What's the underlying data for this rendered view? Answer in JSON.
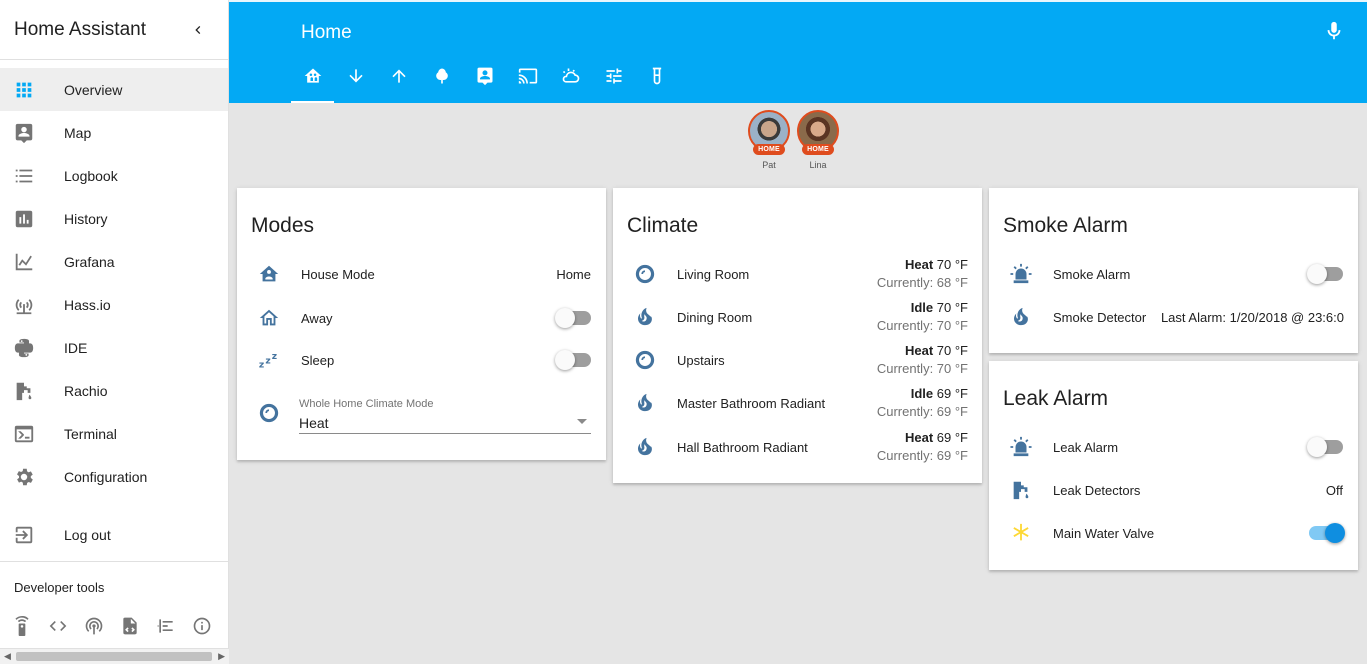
{
  "sidebar": {
    "title": "Home Assistant",
    "items": [
      {
        "label": "Overview",
        "icon": "apps-grid-icon"
      },
      {
        "label": "Map",
        "icon": "map-person-icon"
      },
      {
        "label": "Logbook",
        "icon": "list-icon"
      },
      {
        "label": "History",
        "icon": "bar-chart-icon"
      },
      {
        "label": "Grafana",
        "icon": "line-chart-icon"
      },
      {
        "label": "Hass.io",
        "icon": "antenna-icon"
      },
      {
        "label": "IDE",
        "icon": "python-icon"
      },
      {
        "label": "Rachio",
        "icon": "water-pump-icon"
      },
      {
        "label": "Terminal",
        "icon": "console-icon"
      },
      {
        "label": "Configuration",
        "icon": "gear-icon"
      },
      {
        "label": "Log out",
        "icon": "exit-icon"
      }
    ],
    "dev_tools_title": "Developer tools",
    "dev_tools": [
      "remote-icon",
      "code-icon",
      "radio-tower-icon",
      "file-xml-icon",
      "timeline-icon",
      "info-icon"
    ]
  },
  "header": {
    "title": "Home",
    "tabs": [
      "home-group-icon",
      "arrow-down-icon",
      "arrow-up-icon",
      "tree-icon",
      "account-box-icon",
      "cast-icon",
      "weather-icon",
      "tune-icon",
      "test-tube-icon"
    ]
  },
  "badges": [
    {
      "label": "HOME",
      "name": "Pat"
    },
    {
      "label": "HOME",
      "name": "Lina"
    }
  ],
  "modes": {
    "title": "Modes",
    "house_mode": {
      "name": "House Mode",
      "state": "Home"
    },
    "away": {
      "name": "Away",
      "on": false
    },
    "sleep": {
      "name": "Sleep",
      "on": false
    },
    "climate_mode": {
      "label": "Whole Home Climate Mode",
      "value": "Heat"
    }
  },
  "climate": {
    "title": "Climate",
    "rows": [
      {
        "name": "Living Room",
        "mode": "Heat",
        "target": "70 °F",
        "current": "Currently: 68 °F",
        "icon": "thermostat-icon"
      },
      {
        "name": "Dining Room",
        "mode": "Idle",
        "target": "70 °F",
        "current": "Currently: 70 °F",
        "icon": "fire-icon"
      },
      {
        "name": "Upstairs",
        "mode": "Heat",
        "target": "70 °F",
        "current": "Currently: 70 °F",
        "icon": "thermostat-icon"
      },
      {
        "name": "Master Bathroom Radiant",
        "mode": "Idle",
        "target": "69 °F",
        "current": "Currently: 69 °F",
        "icon": "fire-icon"
      },
      {
        "name": "Hall Bathroom Radiant",
        "mode": "Heat",
        "target": "69 °F",
        "current": "Currently: 69 °F",
        "icon": "fire-icon"
      }
    ]
  },
  "smoke": {
    "title": "Smoke Alarm",
    "alarm": {
      "name": "Smoke Alarm",
      "on": false
    },
    "detector": {
      "name": "Smoke Detector",
      "state": "Last Alarm: 1/20/2018 @ 23:6:0"
    }
  },
  "leak": {
    "title": "Leak Alarm",
    "alarm": {
      "name": "Leak Alarm",
      "on": false
    },
    "detectors": {
      "name": "Leak Detectors",
      "state": "Off"
    },
    "valve": {
      "name": "Main Water Valve",
      "on": true
    }
  },
  "colors": {
    "primary": "#03a9f4",
    "icon": "#44739e",
    "badge": "#df4c1e",
    "toggle_on": "#0f8ee0",
    "valve_icon": "#fdd835"
  }
}
